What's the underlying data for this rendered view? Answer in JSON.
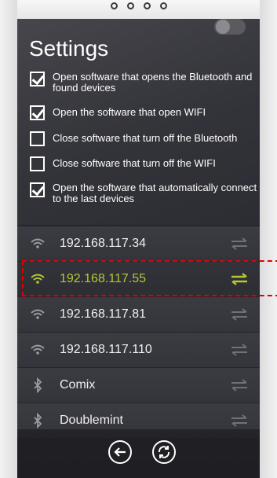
{
  "settings": {
    "title": "Settings",
    "options": [
      {
        "label": "Open software that opens the Bluetooth and found devices",
        "checked": true
      },
      {
        "label": "Open the software that open WIFI",
        "checked": true
      },
      {
        "label": "Close software that turn off the Bluetooth",
        "checked": false
      },
      {
        "label": "Close software that turn off the WIFI",
        "checked": false
      },
      {
        "label": "Open the software that automatically connect to the last devices",
        "checked": true
      }
    ]
  },
  "devices": [
    {
      "name": "192.168.117.34",
      "type": "wifi-icon",
      "selected": false
    },
    {
      "name": "192.168.117.55",
      "type": "wifi-icon",
      "selected": true
    },
    {
      "name": "192.168.117.81",
      "type": "wifi-icon",
      "selected": false
    },
    {
      "name": "192.168.117.110",
      "type": "wifi-icon",
      "selected": false
    },
    {
      "name": "Comix",
      "type": "bluetooth-icon",
      "selected": false
    },
    {
      "name": "Doublemint",
      "type": "bluetooth-icon",
      "selected": false
    }
  ],
  "colors": {
    "accent": "#b5c832",
    "highlight": "#e00000",
    "background": "#25252b"
  },
  "bottom_bar": {
    "back_icon": "back-arrow-icon",
    "refresh_icon": "refresh-icon",
    "toggle_state": "off"
  }
}
